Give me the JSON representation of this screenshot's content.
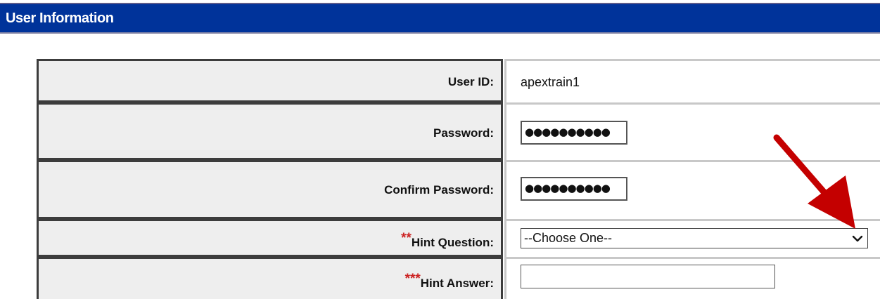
{
  "header": {
    "title": "User Information"
  },
  "form": {
    "user_id": {
      "label": "User ID:",
      "value": "apextrain1"
    },
    "password": {
      "label": "Password:",
      "masked_value": "●●●●●●●●●●"
    },
    "confirm_password": {
      "label": "Confirm Password:",
      "masked_value": "●●●●●●●●●●"
    },
    "hint_question": {
      "required_marker": "**",
      "label": "Hint Question:",
      "selected": "--Choose One--"
    },
    "hint_answer": {
      "required_marker": "***",
      "label": "Hint Answer:",
      "value": ""
    }
  },
  "annotation": {
    "icon": "red-arrow-icon",
    "color": "#c40000"
  },
  "colors": {
    "header_bg": "#00339a",
    "label_bg": "#eeeeee",
    "required": "#cc2222"
  }
}
